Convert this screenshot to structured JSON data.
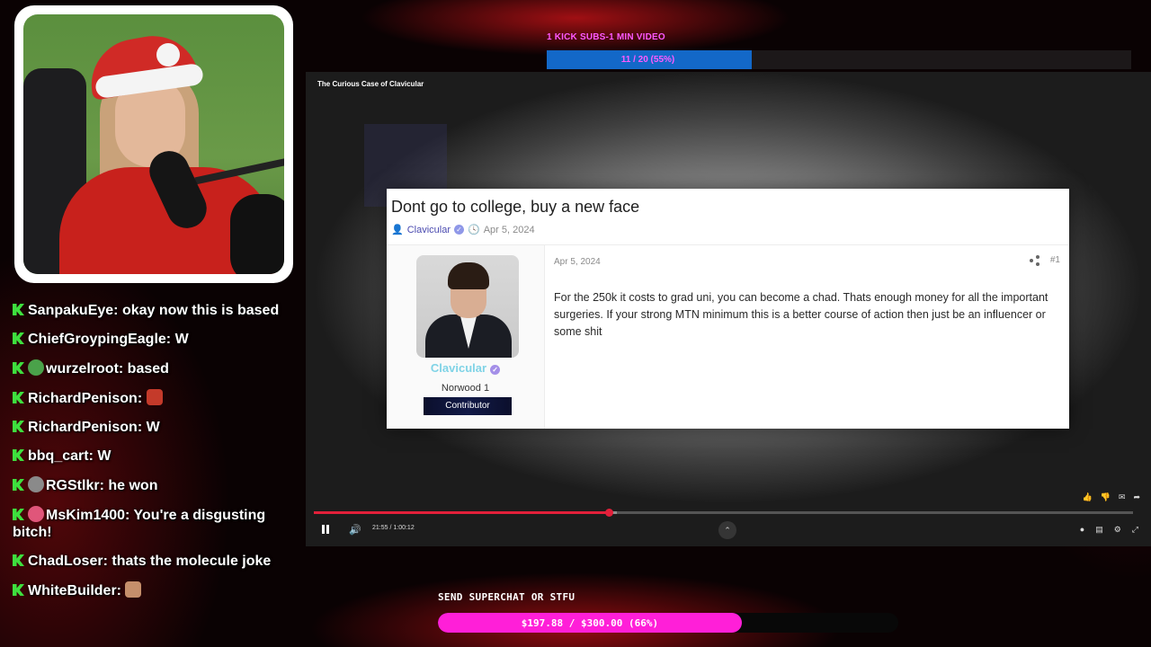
{
  "stream": {
    "subs_goal": {
      "label": "1 KICK SUBS-1 MIN VIDEO",
      "progress_text": "11 / 20 (55%)",
      "fraction": 0.35
    },
    "superchat_goal": {
      "label": "SEND SUPERCHAT OR STFU",
      "progress_text": "$197.88 / $300.00 (66%)",
      "fraction": 0.66
    }
  },
  "chat": {
    "messages": [
      {
        "user": "SanpakuEye",
        "text": "okay now this is based",
        "emote_color": ""
      },
      {
        "user": "ChiefGroypingEagle",
        "text": "W",
        "emote_color": ""
      },
      {
        "user": "wurzelroot",
        "text": "based",
        "emote_color": "#4aa24a"
      },
      {
        "user": "RichardPenison",
        "text": "",
        "emote_color": "",
        "trailing_emote_color": "#c43a2a"
      },
      {
        "user": "RichardPenison",
        "text": "W",
        "emote_color": ""
      },
      {
        "user": "bbq_cart",
        "text": "W",
        "emote_color": ""
      },
      {
        "user": "RGStlkr",
        "text": "he won",
        "emote_color": "#8a8a8a"
      },
      {
        "user": "MsKim1400",
        "text": "You're a disgusting bitch!",
        "emote_color": "#e0567a"
      },
      {
        "user": "ChadLoser",
        "text": "thats the molecule joke",
        "emote_color": ""
      },
      {
        "user": "WhiteBuilder",
        "text": "",
        "emote_color": "",
        "trailing_emote_color": "#c58f6b"
      }
    ]
  },
  "player": {
    "video_title": "The Curious Case of Clavicular",
    "time": "21:55 / 1:00:12",
    "played_fraction": 0.36,
    "buffered_fraction": 0.37
  },
  "post": {
    "thread_title": "Dont go to college, buy a new face",
    "author": "Clavicular",
    "date": "Apr 5, 2024",
    "post_date": "Apr 5, 2024",
    "post_number": "#1",
    "username": "Clavicular",
    "user_title": "Norwood 1",
    "banner": "Contributor",
    "body": "For the 250k it costs to grad uni, you can become a chad. Thats enough money for all the important surgeries. If your strong MTN minimum this is a better course of action then just be an influencer or some shit"
  },
  "icons": {
    "kick": "kick-logo-icon",
    "verified": "verified-badge-icon",
    "share": "share-icon",
    "clock": "clock-icon",
    "user": "user-icon"
  }
}
